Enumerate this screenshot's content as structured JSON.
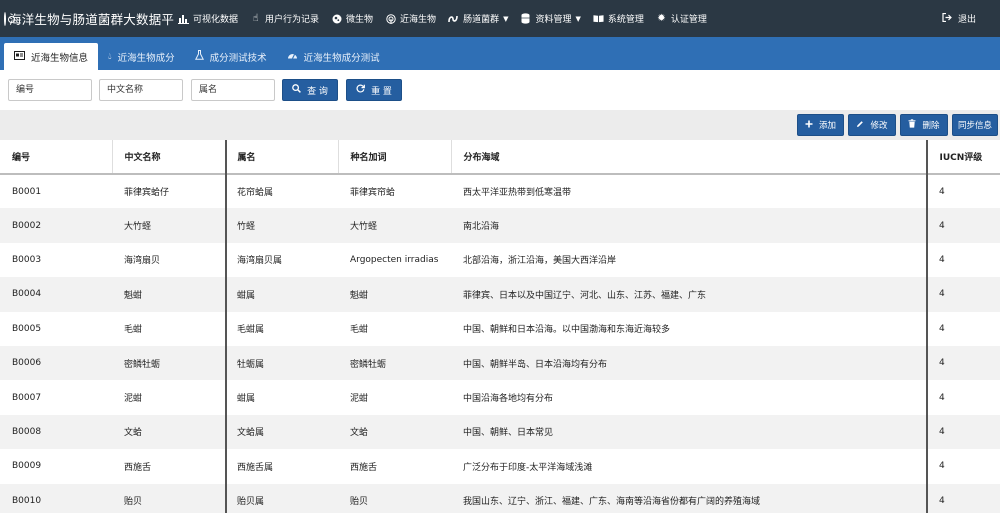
{
  "app": {
    "title": "海洋生物与肠道菌群大数据平"
  },
  "nav": {
    "items": [
      {
        "label": "可视化数据",
        "icon": "bar-chart-icon",
        "caret": false
      },
      {
        "label": "用户行为记录",
        "icon": "pointer-hand-icon",
        "caret": false
      },
      {
        "label": "微生物",
        "icon": "microbe-icon",
        "caret": false
      },
      {
        "label": "近海生物",
        "icon": "radar-icon",
        "caret": false
      },
      {
        "label": "肠道菌群",
        "icon": "flow-icon",
        "caret": true
      },
      {
        "label": "资料管理",
        "icon": "database-icon",
        "caret": true
      },
      {
        "label": "系统管理",
        "icon": "book-icon",
        "caret": false
      },
      {
        "label": "认证管理",
        "icon": "gear-icon",
        "caret": false
      }
    ],
    "logout": "退出"
  },
  "tabs": [
    {
      "label": "近海生物信息",
      "icon": "id-card-icon",
      "active": true
    },
    {
      "label": "近海生物成分",
      "icon": "drop-icon",
      "active": false
    },
    {
      "label": "成分测试技术",
      "icon": "flask-icon",
      "active": false
    },
    {
      "label": "近海生物成分测试",
      "icon": "dashboard-icon",
      "active": false
    }
  ],
  "filters": {
    "code_placeholder": "编号",
    "cn_name_placeholder": "中文名称",
    "genus_placeholder": "属名",
    "query_label": "查 询",
    "reset_label": "重 置"
  },
  "actions": {
    "add_label": "添加",
    "edit_label": "修改",
    "delete_label": "删除",
    "sync_label": "同步信息"
  },
  "table": {
    "columns": [
      "编号",
      "中文名称",
      "属名",
      "种名加词",
      "分布海域",
      "IUCN评级"
    ],
    "rows": [
      [
        "B0001",
        "菲律宾蛤仔",
        "花帘蛤属",
        "菲律宾帘蛤",
        "西太平洋亚热带到低寒温带",
        "4"
      ],
      [
        "B0002",
        "大竹蛏",
        "竹蛏",
        "大竹蛏",
        "南北沿海",
        "4"
      ],
      [
        "B0003",
        "海湾扇贝",
        "海湾扇贝属",
        "Argopecten irradias",
        "北部沿海，浙江沿海，美国大西洋沿岸",
        "4"
      ],
      [
        "B0004",
        "魁蚶",
        "蚶属",
        "魁蚶",
        "菲律宾、日本以及中国辽宁、河北、山东、江苏、福建、广东",
        "4"
      ],
      [
        "B0005",
        "毛蚶",
        "毛蚶属",
        "毛蚶",
        "中国、朝鲜和日本沿海。以中国渤海和东海近海较多",
        "4"
      ],
      [
        "B0006",
        "密鳞牡蛎",
        "牡蛎属",
        "密鳞牡蛎",
        "中国、朝鲜半岛、日本沿海均有分布",
        "4"
      ],
      [
        "B0007",
        "泥蚶",
        "蚶属",
        "泥蚶",
        "中国沿海各地均有分布",
        "4"
      ],
      [
        "B0008",
        "文蛤",
        "文蛤属",
        "文蛤",
        "中国、朝鲜、日本常见",
        "4"
      ],
      [
        "B0009",
        "西施舌",
        "西施舌属",
        "西施舌",
        "广泛分布于印度-太平洋海域浅滩",
        "4"
      ],
      [
        "B0010",
        "贻贝",
        "贻贝属",
        "贻贝",
        "我国山东、辽宁、浙江、福建、广东、海南等沿海省份都有广阔的养殖海域",
        "4"
      ]
    ]
  }
}
